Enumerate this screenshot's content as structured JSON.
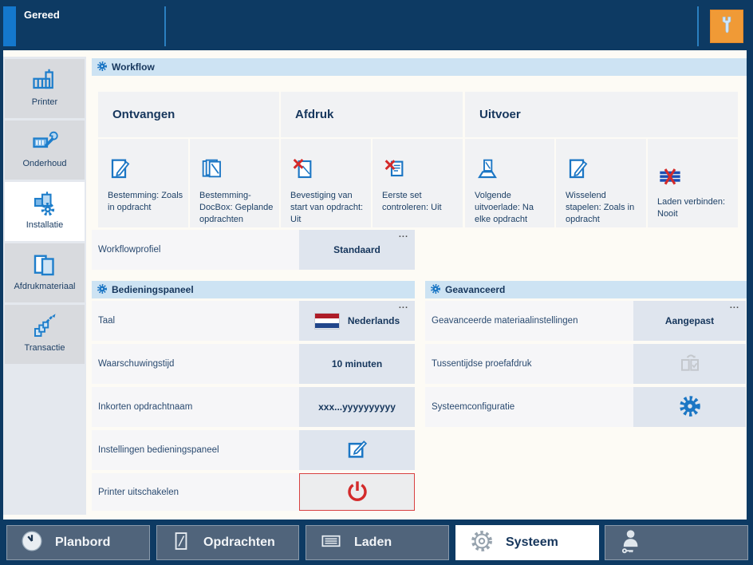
{
  "status_bar": {
    "status": "Gereed"
  },
  "colors": {
    "frame_navy": "#0d3a63",
    "accent_blue": "#1478cd",
    "icon_blue": "#1b76c4",
    "section_header_bg": "#cde3f3",
    "value_bg": "#dfe5ee",
    "danger_red": "#d32b2b",
    "wrench_button_orange": "#f09a36",
    "flag_red": "#ae1c28",
    "flag_blue": "#21468b"
  },
  "sidebar": {
    "items": [
      {
        "label": "Printer"
      },
      {
        "label": "Onderhoud"
      },
      {
        "label": "Installatie",
        "selected": true
      },
      {
        "label": "Afdrukmateriaal"
      },
      {
        "label": "Transactie"
      }
    ]
  },
  "workflow": {
    "title": "Workflow",
    "groups": [
      {
        "label": "Ontvangen"
      },
      {
        "label": "Afdruk"
      },
      {
        "label": "Uitvoer"
      }
    ],
    "items": [
      {
        "label": "Bestemming: Zoals in opdracht",
        "icon": "doc-edit-icon"
      },
      {
        "label": "Bestemming-DocBox: Geplande opdrachten",
        "icon": "docs-stack-icon"
      },
      {
        "label": "Bevestiging van start van opdracht: Uit",
        "icon": "doc-cancel-icon"
      },
      {
        "label": "Eerste set controleren: Uit",
        "icon": "doc-cancel-icon"
      },
      {
        "label": "Volgende uitvoerlade: Na elke opdracht",
        "icon": "output-tray-icon"
      },
      {
        "label": "Wisselend stapelen: Zoals in opdracht",
        "icon": "doc-edit-icon"
      },
      {
        "label": "Laden verbinden: Nooit",
        "icon": "trays-cancel-icon"
      }
    ],
    "profile_row": {
      "label": "Workflowprofiel",
      "value": "Standaard",
      "more": "..."
    }
  },
  "control_panel": {
    "title": "Bedieningspaneel",
    "rows": [
      {
        "label": "Taal",
        "value": "Nederlands",
        "more": "...",
        "icon": "nl-flag-icon"
      },
      {
        "label": "Waarschuwingstijd",
        "value": "10 minuten"
      },
      {
        "label": "Inkorten opdrachtnaam",
        "value": "xxx...yyyyyyyyyy"
      },
      {
        "label": "Instellingen bedieningspaneel",
        "icon": "edit-square-icon"
      },
      {
        "label": "Printer uitschakelen",
        "icon": "power-icon"
      }
    ]
  },
  "advanced": {
    "title": "Geavanceerd",
    "rows": [
      {
        "label": "Geavanceerde materiaalinstellingen",
        "value": "Aangepast",
        "more": "..."
      },
      {
        "label": "Tussentijdse proefafdruk",
        "icon": "proof-print-icon",
        "disabled": true
      },
      {
        "label": "Systeemconfiguratie",
        "icon": "gear-icon"
      }
    ]
  },
  "bottom_nav": {
    "tabs": [
      {
        "label": "Planbord",
        "icon": "clock-icon"
      },
      {
        "label": "Opdrachten",
        "icon": "document-icon"
      },
      {
        "label": "Laden",
        "icon": "tray-icon"
      },
      {
        "label": "Systeem",
        "icon": "gear-icon",
        "selected": true
      },
      {
        "label": "",
        "icon": "user-key-icon"
      }
    ]
  }
}
